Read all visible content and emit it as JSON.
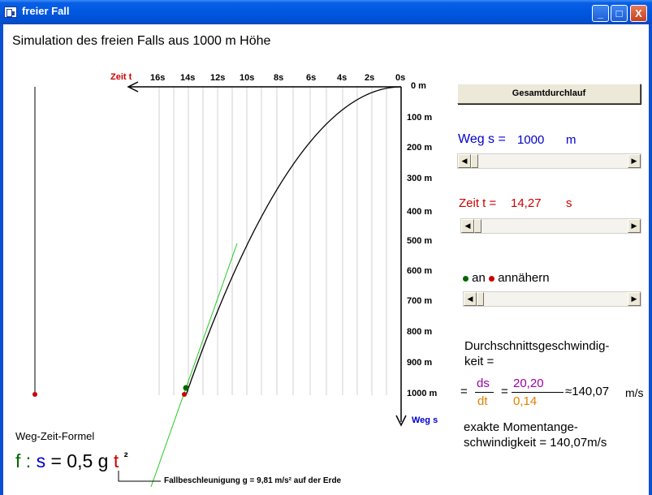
{
  "window": {
    "title": "freier Fall",
    "min_glyph": "_",
    "max_glyph": "□",
    "close_glyph": "X"
  },
  "heading": "Simulation des freien Falls aus 1000 m Höhe",
  "graph": {
    "time_axis_label": "Zeit t",
    "time_ticks": [
      "16s",
      "14s",
      "12s",
      "10s",
      "8s",
      "6s",
      "4s",
      "2s",
      "0s"
    ],
    "distance_ticks": [
      "0 m",
      "100 m",
      "200 m",
      "300 m",
      "400 m",
      "500 m",
      "600 m",
      "700 m",
      "800 m",
      "900 m",
      "1000 m"
    ],
    "distance_axis_label": "Weg s"
  },
  "controls": {
    "run_button": "Gesamtdurchlauf",
    "distance_label": "Weg s =",
    "distance_value": "1000",
    "distance_unit": "m",
    "time_label": "Zeit t =",
    "time_value": "14,27",
    "time_unit": "s",
    "approach_on": "an",
    "approach_text": "annähern",
    "avg_speed_label_1": "Durchschnittsgeschwindig-",
    "avg_speed_label_2": "keit =",
    "ds": "ds",
    "dt": "dt",
    "ds_value": "20,20",
    "dt_value": "0,14",
    "avg_speed_result": "≈140,07",
    "avg_speed_unit": "m/s",
    "exact_label_1": "exakte Momentange-",
    "exact_label_2": "schwindigkeit = 140,07m/s"
  },
  "formula": {
    "title": "Weg-Zeit-Formel",
    "f": "f",
    "colon": ":",
    "s": "s",
    "equals": "= 0,5",
    "g": "g",
    "t": "t",
    "exp": "²",
    "note": "Fallbeschleunigung g = 9,81 m/s² auf der Erde"
  },
  "colors": {
    "time": "#cc0000",
    "distance": "#0000cc",
    "green": "#006600",
    "purple": "#9900aa",
    "orange": "#e08000"
  }
}
